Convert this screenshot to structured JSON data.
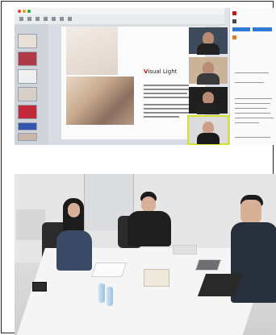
{
  "brand_colors": {
    "accent": "#c4161c",
    "active_speaker": "#d4e02a",
    "button_blue": "#2d7bd6"
  },
  "slide": {
    "logo_prefix": "V",
    "logo_rest": "isual Light"
  },
  "thumbnail_count": 7,
  "video_tile_count": 4,
  "icons": [
    "toolbar-icon",
    "chat-avatar-icon"
  ]
}
